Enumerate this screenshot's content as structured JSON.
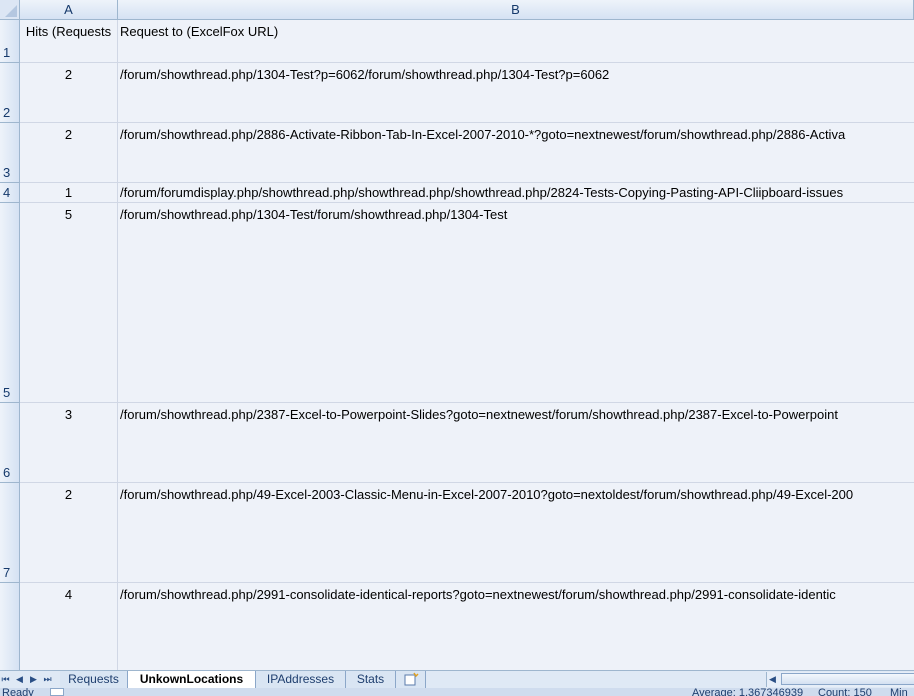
{
  "columns": {
    "a": "A",
    "b": "B"
  },
  "rows": [
    {
      "num": "1",
      "hits": "Hits (Requests",
      "url": "Request to (ExcelFox URL)"
    },
    {
      "num": "2",
      "hits": "2",
      "url": "/forum/showthread.php/1304-Test?p=6062/forum/showthread.php/1304-Test?p=6062"
    },
    {
      "num": "3",
      "hits": "2",
      "url": "/forum/showthread.php/2886-Activate-Ribbon-Tab-In-Excel-2007-2010-*?goto=nextnewest/forum/showthread.php/2886-Activa"
    },
    {
      "num": "4",
      "hits": "1",
      "url": "/forum/forumdisplay.php/showthread.php/showthread.php/showthread.php/2824-Tests-Copying-Pasting-API-Cliipboard-issues"
    },
    {
      "num": "5",
      "hits": "5",
      "url": "/forum/showthread.php/1304-Test/forum/showthread.php/1304-Test"
    },
    {
      "num": "6",
      "hits": "3",
      "url": "/forum/showthread.php/2387-Excel-to-Powerpoint-Slides?goto=nextnewest/forum/showthread.php/2387-Excel-to-Powerpoint"
    },
    {
      "num": "7",
      "hits": "2",
      "url": "/forum/showthread.php/49-Excel-2003-Classic-Menu-in-Excel-2007-2010?goto=nextoldest/forum/showthread.php/49-Excel-200"
    },
    {
      "num": "",
      "hits": "4",
      "url": "/forum/showthread.php/2991-consolidate-identical-reports?goto=nextnewest/forum/showthread.php/2991-consolidate-identic"
    }
  ],
  "tabs": [
    "Requests",
    "UnkownLocations",
    "IPAddresses",
    "Stats"
  ],
  "active_tab": "UnkownLocations",
  "status": {
    "ready": "Ready",
    "average": "Average: 1.367346939",
    "count": "Count: 150",
    "min": "Min"
  },
  "colors": {
    "header": "#d5e2f3",
    "grid": "#d0d7e5",
    "cell_fill": "#eef2f9",
    "active_tab": "#ffffff"
  }
}
